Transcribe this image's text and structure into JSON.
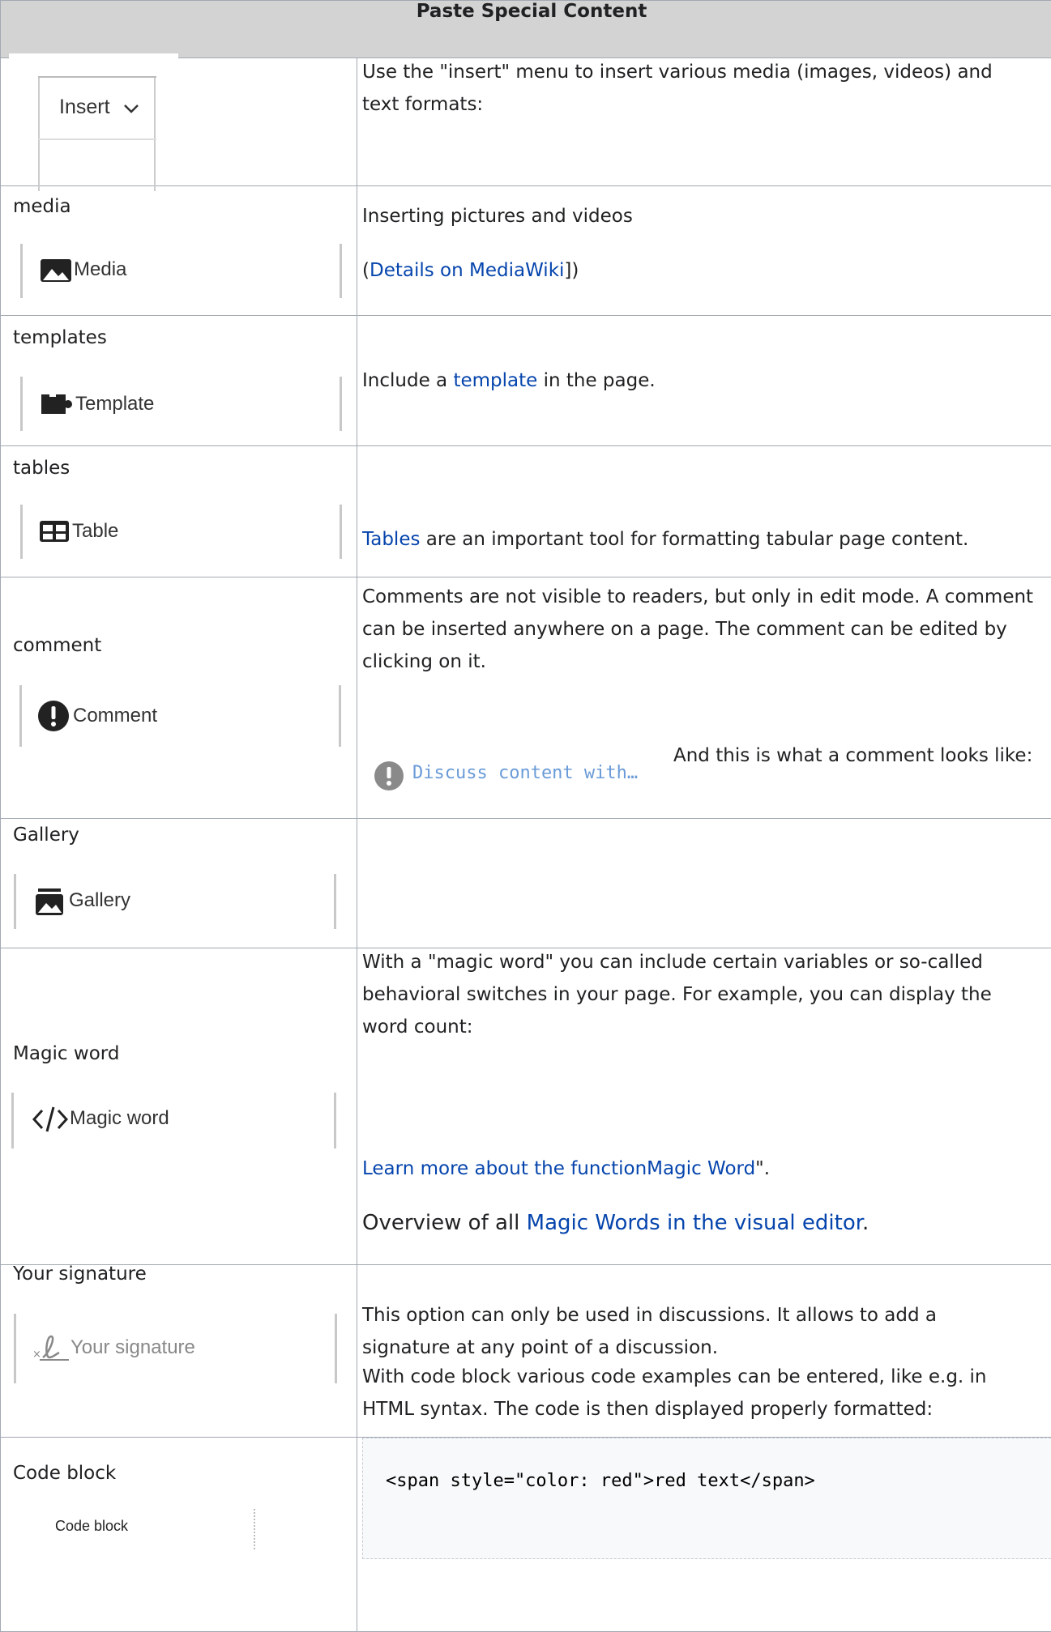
{
  "table": {
    "header": "Paste Special Content",
    "rows": [
      {
        "label": "",
        "button": "Insert",
        "description": "Use the \"insert\" menu to insert various media (images, videos) and text formats:"
      },
      {
        "label": "media",
        "button": "Media",
        "description": "Inserting pictures and videos",
        "link_prefix": "(",
        "link_text": "Details on MediaWiki",
        "link_suffix": "])"
      },
      {
        "label": "templates",
        "button": "Template",
        "desc_before": "Include a ",
        "desc_link": "template",
        "desc_after": " in the page."
      },
      {
        "label": "tables",
        "button": "Table",
        "desc_link": "Tables",
        "desc_after": " are an important tool for formatting tabular page content."
      },
      {
        "label": "comment",
        "button": "Comment",
        "description": "Comments are not visible to readers, but only in edit mode. A comment can be inserted anywhere on a page. The comment can be edited by clicking on it.",
        "preview_text": "Discuss content with…",
        "preview_caption": "And this is what a comment looks like:"
      },
      {
        "label": "Gallery",
        "button": "Gallery"
      },
      {
        "label": "Magic word",
        "button": "Magic word",
        "description": "With a \"magic word\" you can include certain variables or so-called behavioral switches in your page. For example, you can display the word count:",
        "learn_link": "Learn more about the functionMagic Word",
        "learn_suffix": "\".",
        "overview_prefix": "Overview of all ",
        "overview_link": "Magic Words in the visual editor",
        "overview_suffix": "."
      },
      {
        "label": "Your signature",
        "button": "Your signature",
        "description": "This option can only be used in discussions. It allows to add a signature at any point of a discussion."
      },
      {
        "label": "Code block",
        "button": "Code block",
        "description": "With code block various code examples can be entered, like e.g. in HTML syntax. The code is then displayed properly formatted:",
        "code": "<span style=\"color: red\">red text</span>"
      }
    ]
  },
  "icons": {
    "insert_chevron": "chevron-down-icon",
    "media": "image-icon",
    "template": "puzzle-icon",
    "table": "table-icon",
    "comment": "exclamation-circle-icon",
    "gallery": "gallery-icon",
    "magic": "code-brackets-icon",
    "signature": "signature-icon"
  },
  "colors": {
    "link": "#0645ad",
    "header_bg": "#d3d3d3",
    "border": "#a2a9b1",
    "comment_preview_text": "#6a9bd8"
  }
}
